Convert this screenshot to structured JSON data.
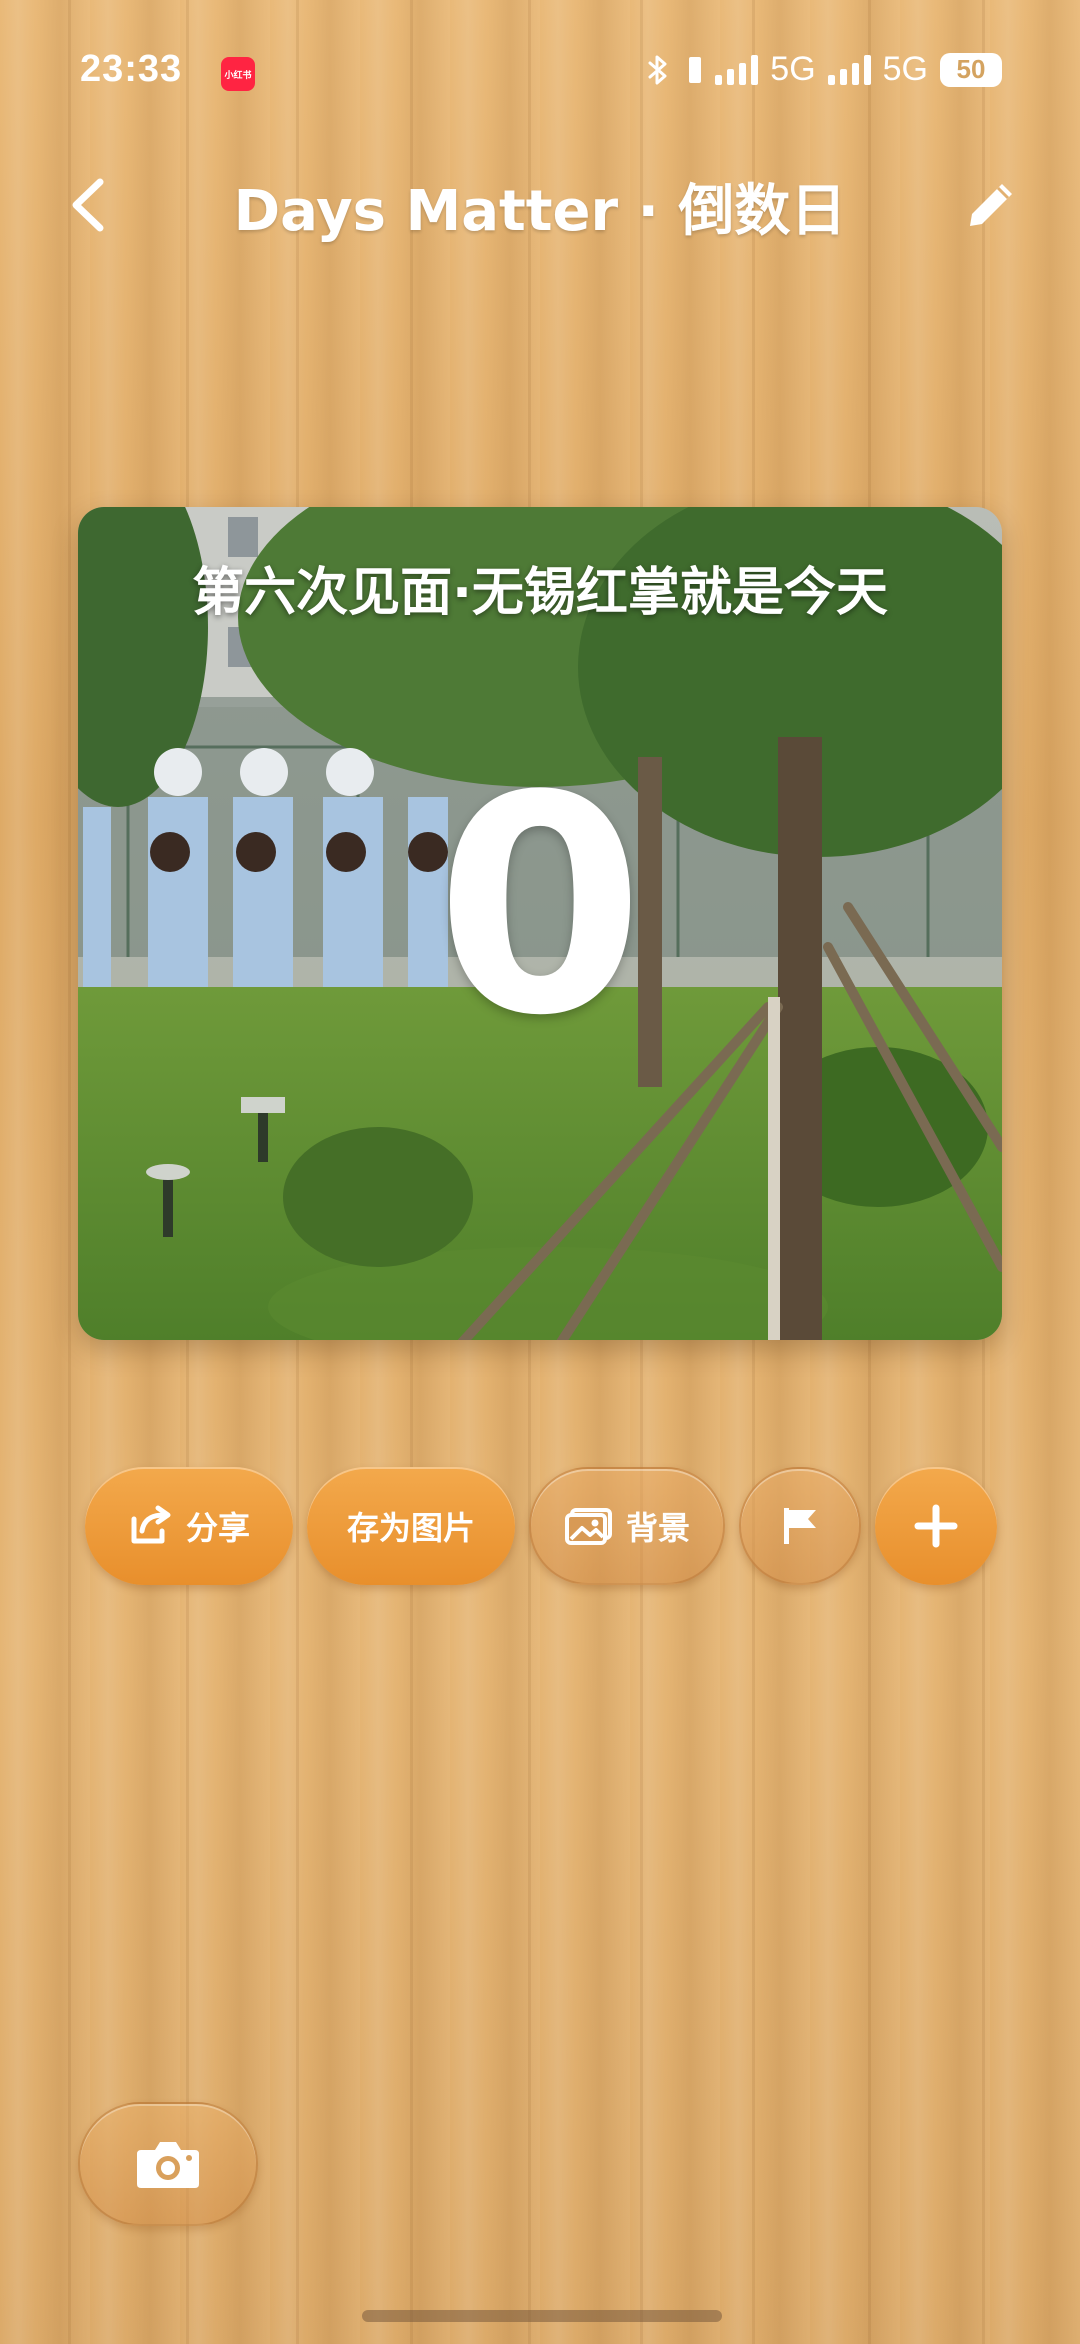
{
  "status_bar": {
    "time": "23:33",
    "app_badge": "小红书",
    "network_1": "5G",
    "network_2": "5G",
    "battery": "50"
  },
  "header": {
    "title": "Days Matter · 倒数日",
    "back_icon": "chevron-left-icon",
    "edit_icon": "pencil-icon"
  },
  "card": {
    "title": "第六次见面·无锡红掌就是今天",
    "days": "0"
  },
  "actions": {
    "share_label": "分享",
    "save_image_label": "存为图片",
    "background_label": "背景",
    "flag_icon": "flag-icon",
    "add_icon": "plus-icon"
  },
  "bottom": {
    "camera_icon": "camera-icon"
  },
  "colors": {
    "accent_orange": "#ec972f",
    "wood": "#e2b172",
    "text": "#ffffff"
  }
}
